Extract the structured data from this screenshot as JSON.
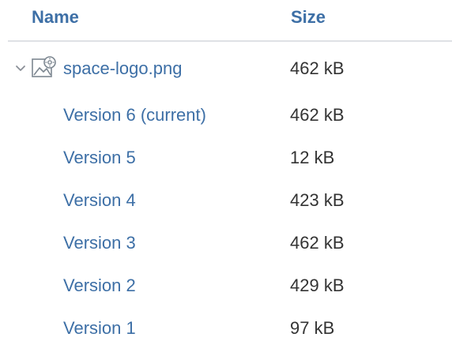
{
  "columns": {
    "name": "Name",
    "size": "Size"
  },
  "file": {
    "name": "space-logo.png",
    "size": "462 kB",
    "expanded": true,
    "icon": "image-file-icon"
  },
  "versions": [
    {
      "label": "Version 6 (current)",
      "size": "462 kB"
    },
    {
      "label": "Version 5",
      "size": "12 kB"
    },
    {
      "label": "Version 4",
      "size": "423 kB"
    },
    {
      "label": "Version 3",
      "size": "462 kB"
    },
    {
      "label": "Version 2",
      "size": "429 kB"
    },
    {
      "label": "Version 1",
      "size": "97 kB"
    }
  ],
  "colors": {
    "link": "#3d6fa6",
    "text": "#333333",
    "divider": "#dfe1e5"
  }
}
